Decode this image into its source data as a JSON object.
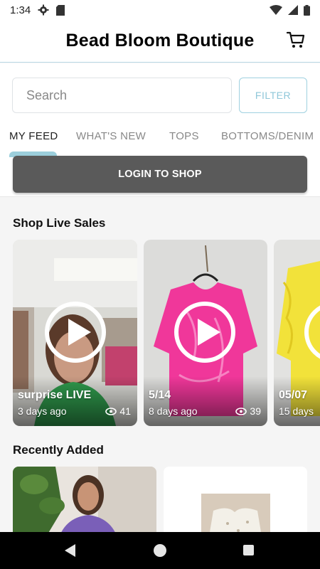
{
  "status_bar": {
    "time": "1:34",
    "icons": [
      "gear-icon",
      "sd-card-icon",
      "wifi-icon",
      "signal-icon",
      "battery-icon"
    ]
  },
  "header": {
    "title": "Bead Bloom Boutique",
    "cart_icon": "cart-icon"
  },
  "search": {
    "placeholder": "Search",
    "filter_label": "FILTER"
  },
  "tabs": [
    {
      "label": "MY FEED",
      "active": true
    },
    {
      "label": "WHAT'S NEW",
      "active": false
    },
    {
      "label": "TOPS",
      "active": false
    },
    {
      "label": "BOTTOMS/DENIM",
      "active": false
    }
  ],
  "login": {
    "label": "LOGIN TO SHOP"
  },
  "live_sales": {
    "title": "Shop Live Sales",
    "items": [
      {
        "title": "surprise LIVE",
        "date": "3 days ago",
        "views": "41"
      },
      {
        "title": "5/14",
        "date": "8 days ago",
        "views": "39"
      },
      {
        "title": "05/07",
        "date": "15 days",
        "views": ""
      }
    ]
  },
  "recently_added": {
    "title": "Recently Added"
  },
  "colors": {
    "accent": "#9ccfdc",
    "login_bg": "#5a5a5a",
    "pink_shirt": "#f0379a",
    "yellow_shirt": "#f2e23a"
  },
  "nav": {
    "back_icon": "back-icon",
    "home_icon": "home-icon",
    "recents_icon": "recents-icon"
  }
}
